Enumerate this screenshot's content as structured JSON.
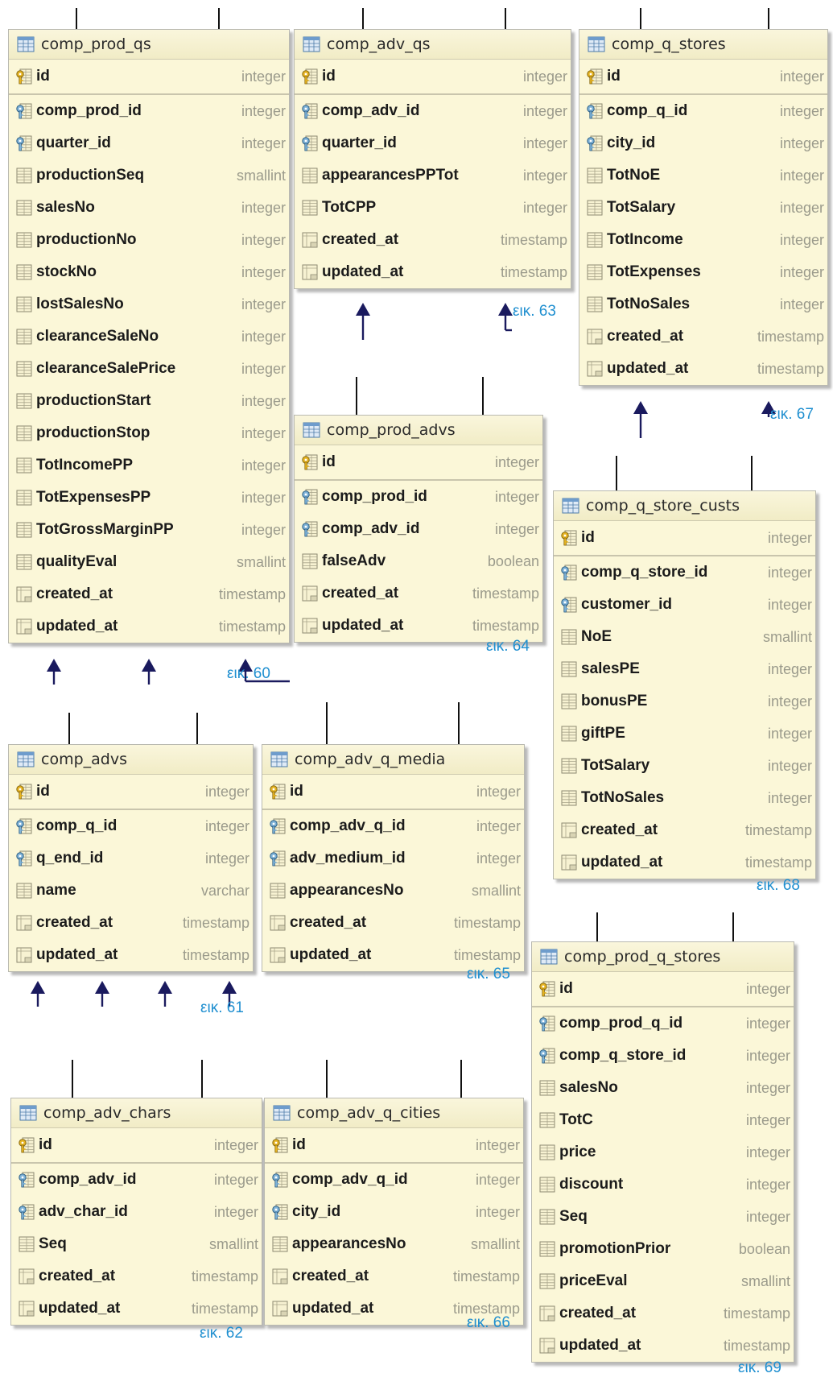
{
  "tables": [
    {
      "name": "comp_prod_qs",
      "label": "εικ. 60",
      "columns": [
        [
          "id",
          "integer",
          "pk"
        ],
        [
          "comp_prod_id",
          "integer",
          "fk"
        ],
        [
          "quarter_id",
          "integer",
          "fk"
        ],
        [
          "productionSeq",
          "smallint",
          "col"
        ],
        [
          "salesNo",
          "integer",
          "col"
        ],
        [
          "productionNo",
          "integer",
          "col"
        ],
        [
          "stockNo",
          "integer",
          "col"
        ],
        [
          "lostSalesNo",
          "integer",
          "col"
        ],
        [
          "clearanceSaleNo",
          "integer",
          "col"
        ],
        [
          "clearanceSalePrice",
          "integer",
          "col"
        ],
        [
          "productionStart",
          "integer",
          "col"
        ],
        [
          "productionStop",
          "integer",
          "col"
        ],
        [
          "TotIncomePP",
          "integer",
          "col"
        ],
        [
          "TotExpensesPP",
          "integer",
          "col"
        ],
        [
          "TotGrossMarginPP",
          "integer",
          "col"
        ],
        [
          "qualityEval",
          "smallint",
          "col"
        ],
        [
          "created_at",
          "timestamp",
          "ts"
        ],
        [
          "updated_at",
          "timestamp",
          "ts"
        ]
      ]
    },
    {
      "name": "comp_adv_qs",
      "label": "εικ. 63",
      "columns": [
        [
          "id",
          "integer",
          "pk"
        ],
        [
          "comp_adv_id",
          "integer",
          "fk"
        ],
        [
          "quarter_id",
          "integer",
          "fk"
        ],
        [
          "appearancesPPTot",
          "integer",
          "col"
        ],
        [
          "TotCPP",
          "integer",
          "col"
        ],
        [
          "created_at",
          "timestamp",
          "ts"
        ],
        [
          "updated_at",
          "timestamp",
          "ts"
        ]
      ]
    },
    {
      "name": "comp_q_stores",
      "label": "εικ. 67",
      "columns": [
        [
          "id",
          "integer",
          "pk"
        ],
        [
          "comp_q_id",
          "integer",
          "fk"
        ],
        [
          "city_id",
          "integer",
          "fk"
        ],
        [
          "TotNoE",
          "integer",
          "col"
        ],
        [
          "TotSalary",
          "integer",
          "col"
        ],
        [
          "TotIncome",
          "integer",
          "col"
        ],
        [
          "TotExpenses",
          "integer",
          "col"
        ],
        [
          "TotNoSales",
          "integer",
          "col"
        ],
        [
          "created_at",
          "timestamp",
          "ts"
        ],
        [
          "updated_at",
          "timestamp",
          "ts"
        ]
      ]
    },
    {
      "name": "comp_prod_advs",
      "label": "εικ. 64",
      "columns": [
        [
          "id",
          "integer",
          "pk"
        ],
        [
          "comp_prod_id",
          "integer",
          "fk"
        ],
        [
          "comp_adv_id",
          "integer",
          "fk"
        ],
        [
          "falseAdv",
          "boolean",
          "col"
        ],
        [
          "created_at",
          "timestamp",
          "ts"
        ],
        [
          "updated_at",
          "timestamp",
          "ts"
        ]
      ]
    },
    {
      "name": "comp_q_store_custs",
      "label": "εικ. 68",
      "columns": [
        [
          "id",
          "integer",
          "pk"
        ],
        [
          "comp_q_store_id",
          "integer",
          "fk"
        ],
        [
          "customer_id",
          "integer",
          "fk"
        ],
        [
          "NoE",
          "smallint",
          "col"
        ],
        [
          "salesPE",
          "integer",
          "col"
        ],
        [
          "bonusPE",
          "integer",
          "col"
        ],
        [
          "giftPE",
          "integer",
          "col"
        ],
        [
          "TotSalary",
          "integer",
          "col"
        ],
        [
          "TotNoSales",
          "integer",
          "col"
        ],
        [
          "created_at",
          "timestamp",
          "ts"
        ],
        [
          "updated_at",
          "timestamp",
          "ts"
        ]
      ]
    },
    {
      "name": "comp_advs",
      "label": "εικ. 61",
      "columns": [
        [
          "id",
          "integer",
          "pk"
        ],
        [
          "comp_q_id",
          "integer",
          "fk"
        ],
        [
          "q_end_id",
          "integer",
          "fk"
        ],
        [
          "name",
          "varchar",
          "col"
        ],
        [
          "created_at",
          "timestamp",
          "ts"
        ],
        [
          "updated_at",
          "timestamp",
          "ts"
        ]
      ]
    },
    {
      "name": "comp_adv_q_media",
      "label": "εικ. 65",
      "columns": [
        [
          "id",
          "integer",
          "pk"
        ],
        [
          "comp_adv_q_id",
          "integer",
          "fk"
        ],
        [
          "adv_medium_id",
          "integer",
          "fk"
        ],
        [
          "appearancesNo",
          "smallint",
          "col"
        ],
        [
          "created_at",
          "timestamp",
          "ts"
        ],
        [
          "updated_at",
          "timestamp",
          "ts"
        ]
      ]
    },
    {
      "name": "comp_prod_q_stores",
      "label": "εικ. 69",
      "columns": [
        [
          "id",
          "integer",
          "pk"
        ],
        [
          "comp_prod_q_id",
          "integer",
          "fk"
        ],
        [
          "comp_q_store_id",
          "integer",
          "fk"
        ],
        [
          "salesNo",
          "integer",
          "col"
        ],
        [
          "TotC",
          "integer",
          "col"
        ],
        [
          "price",
          "integer",
          "col"
        ],
        [
          "discount",
          "integer",
          "col"
        ],
        [
          "Seq",
          "integer",
          "col"
        ],
        [
          "promotionPrior",
          "boolean",
          "col"
        ],
        [
          "priceEval",
          "smallint",
          "col"
        ],
        [
          "created_at",
          "timestamp",
          "ts"
        ],
        [
          "updated_at",
          "timestamp",
          "ts"
        ]
      ]
    },
    {
      "name": "comp_adv_chars",
      "label": "εικ. 62",
      "columns": [
        [
          "id",
          "integer",
          "pk"
        ],
        [
          "comp_adv_id",
          "integer",
          "fk"
        ],
        [
          "adv_char_id",
          "integer",
          "fk"
        ],
        [
          "Seq",
          "smallint",
          "col"
        ],
        [
          "created_at",
          "timestamp",
          "ts"
        ],
        [
          "updated_at",
          "timestamp",
          "ts"
        ]
      ]
    },
    {
      "name": "comp_adv_q_cities",
      "label": "εικ. 66",
      "columns": [
        [
          "id",
          "integer",
          "pk"
        ],
        [
          "comp_adv_q_id",
          "integer",
          "fk"
        ],
        [
          "city_id",
          "integer",
          "fk"
        ],
        [
          "appearancesNo",
          "smallint",
          "col"
        ],
        [
          "created_at",
          "timestamp",
          "ts"
        ],
        [
          "updated_at",
          "timestamp",
          "ts"
        ]
      ]
    }
  ],
  "colors": {
    "table_bg": "#fbf7d8",
    "label": "#1f8fd0",
    "arrow": "#1a1a5e",
    "type_text": "#9b9b8c"
  },
  "icons": {
    "pk": "key-column-icon",
    "fk": "foreign-key-column-icon",
    "col": "column-icon",
    "ts": "timestamp-column-icon",
    "table": "table-icon"
  }
}
